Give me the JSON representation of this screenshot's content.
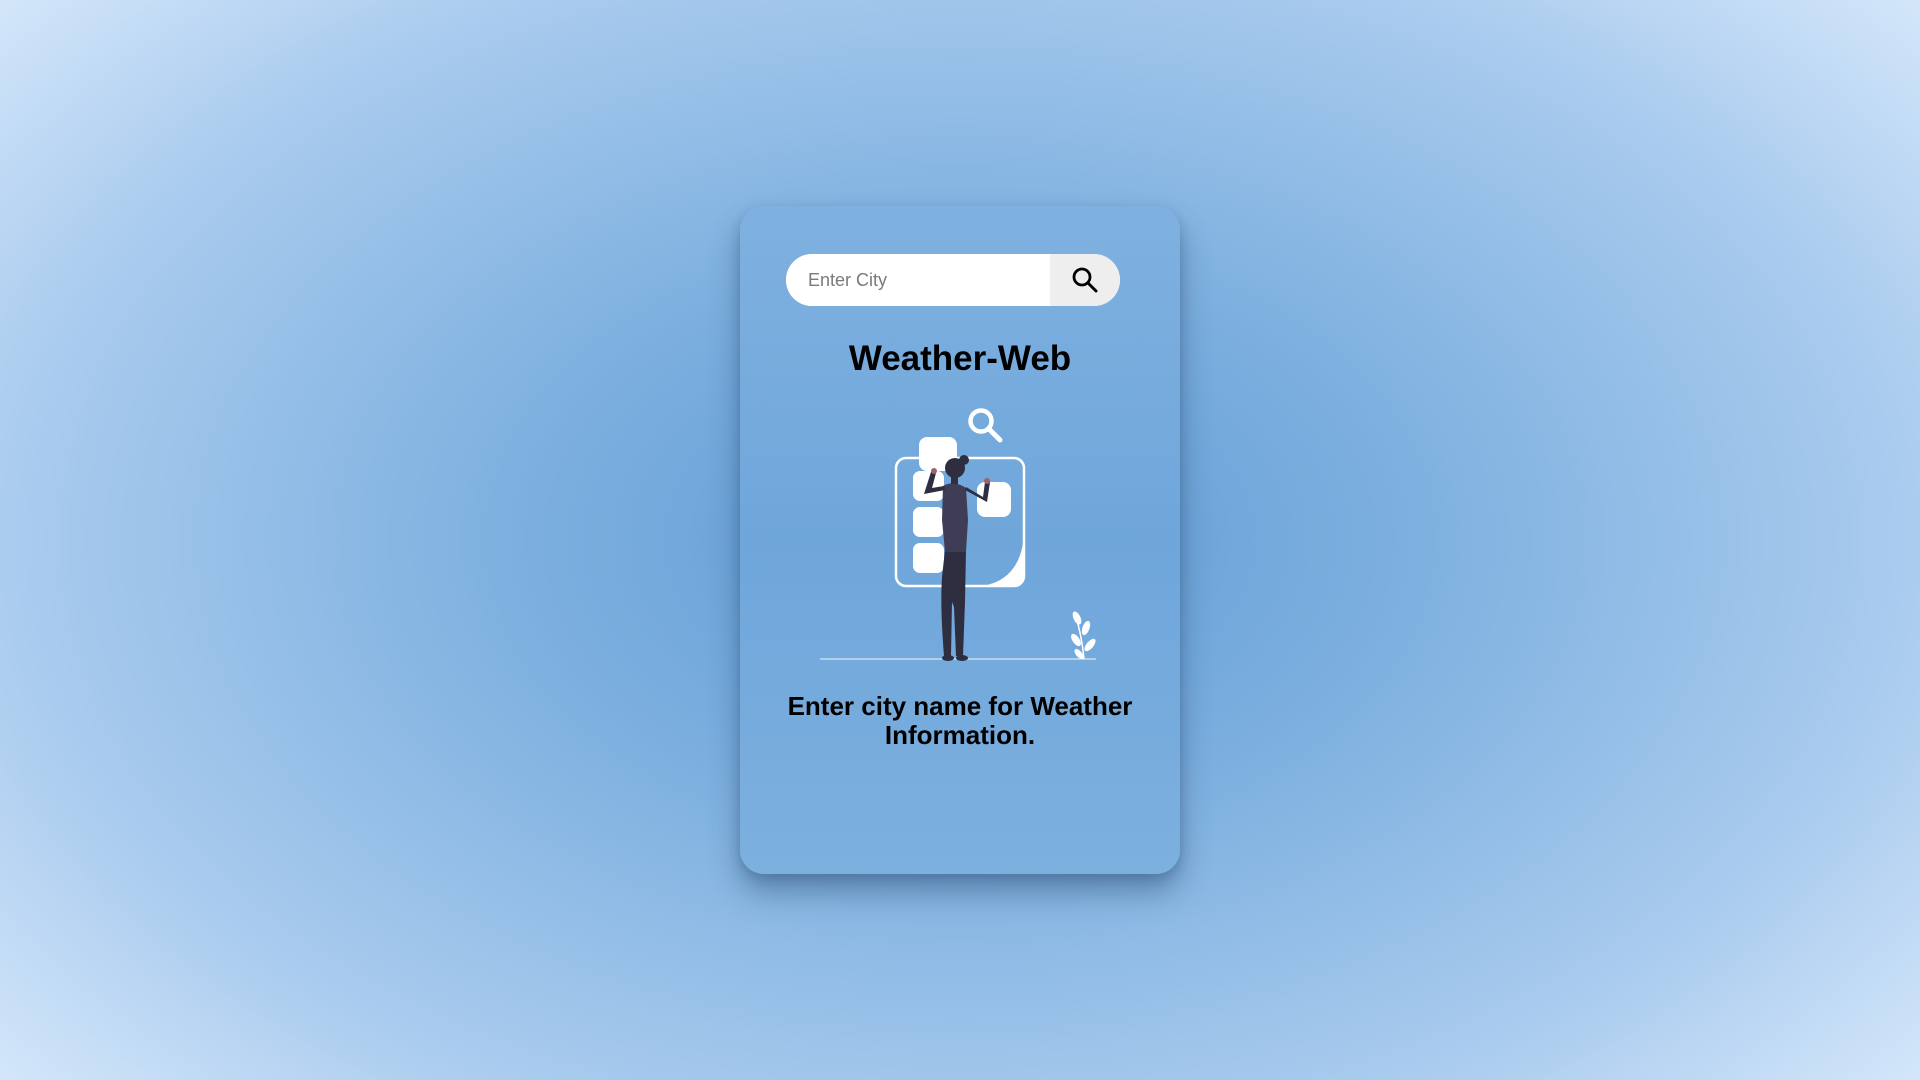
{
  "search": {
    "placeholder": "Enter City",
    "value": "",
    "button_icon": "search-icon"
  },
  "app": {
    "title": "Weather-Web"
  },
  "illustration": {
    "icon": "weather-search-illustration"
  },
  "message": {
    "text": "Enter city name for Weather Information."
  },
  "colors": {
    "card_background": "#6fa6da",
    "page_background": "#a9cbee",
    "search_button_bg": "#eeeeee",
    "text": "#000000",
    "illustration_figure": "#2f2e41"
  }
}
